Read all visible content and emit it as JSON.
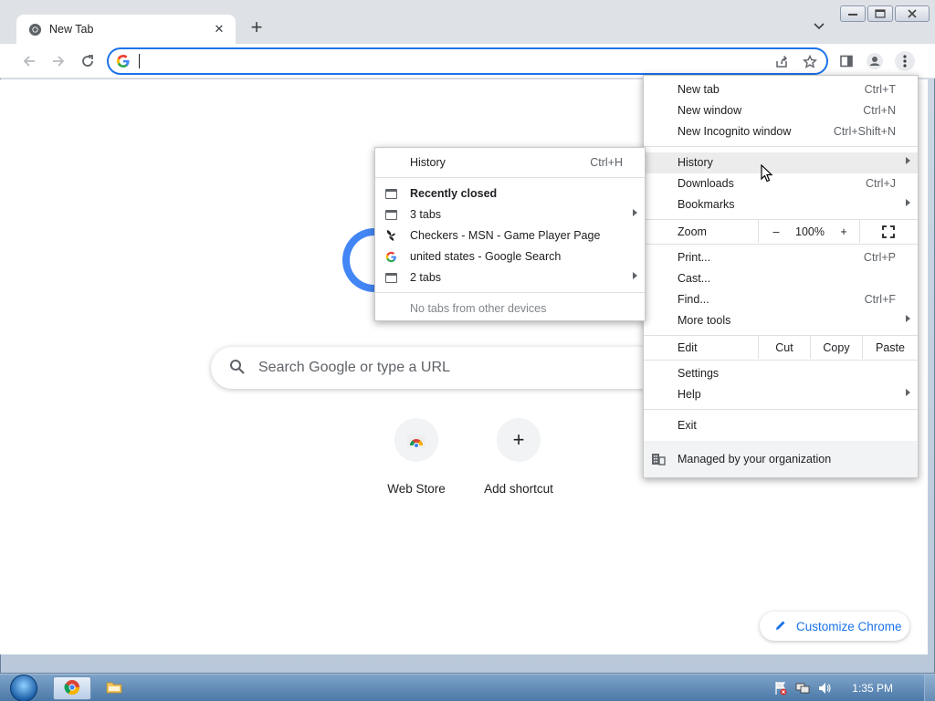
{
  "browser": {
    "tab_title": "New Tab",
    "new_tab_symbol": "+",
    "omnibox_value": ""
  },
  "page": {
    "search_placeholder": "Search Google or type a URL",
    "shortcuts": [
      {
        "label": "Web Store",
        "icon": "webstore-icon"
      },
      {
        "label": "Add shortcut",
        "icon": "plus-icon",
        "symbol": "+"
      }
    ],
    "customize_label": "Customize Chrome"
  },
  "main_menu": {
    "new_tab": {
      "label": "New tab",
      "shortcut": "Ctrl+T"
    },
    "new_window": {
      "label": "New window",
      "shortcut": "Ctrl+N"
    },
    "new_incognito": {
      "label": "New Incognito window",
      "shortcut": "Ctrl+Shift+N"
    },
    "history": {
      "label": "History"
    },
    "downloads": {
      "label": "Downloads",
      "shortcut": "Ctrl+J"
    },
    "bookmarks": {
      "label": "Bookmarks"
    },
    "zoom": {
      "label": "Zoom",
      "minus": "–",
      "value": "100%",
      "plus": "+"
    },
    "print": {
      "label": "Print...",
      "shortcut": "Ctrl+P"
    },
    "cast": {
      "label": "Cast..."
    },
    "find": {
      "label": "Find...",
      "shortcut": "Ctrl+F"
    },
    "more_tools": {
      "label": "More tools"
    },
    "edit": {
      "label": "Edit",
      "cut": "Cut",
      "copy": "Copy",
      "paste": "Paste"
    },
    "settings": {
      "label": "Settings"
    },
    "help": {
      "label": "Help"
    },
    "exit": {
      "label": "Exit"
    },
    "managed": {
      "label": "Managed by your organization"
    }
  },
  "history_submenu": {
    "history": {
      "label": "History",
      "shortcut": "Ctrl+H"
    },
    "recently_closed": "Recently closed",
    "items": [
      {
        "label": "3 tabs",
        "icon": "tab-window-icon",
        "has_submenu": true
      },
      {
        "label": "Checkers - MSN - Game Player Page",
        "icon": "msn-butterfly-icon",
        "has_submenu": false
      },
      {
        "label": "united states - Google Search",
        "icon": "google-g-icon",
        "has_submenu": false
      },
      {
        "label": "2 tabs",
        "icon": "tab-window-icon",
        "has_submenu": true
      }
    ],
    "no_tabs": "No tabs from other devices"
  },
  "taskbar": {
    "clock": "1:35 PM"
  },
  "colors": {
    "accent": "#1a73e8",
    "google_blue": "#4285f4",
    "menu_highlight": "#ececec"
  }
}
